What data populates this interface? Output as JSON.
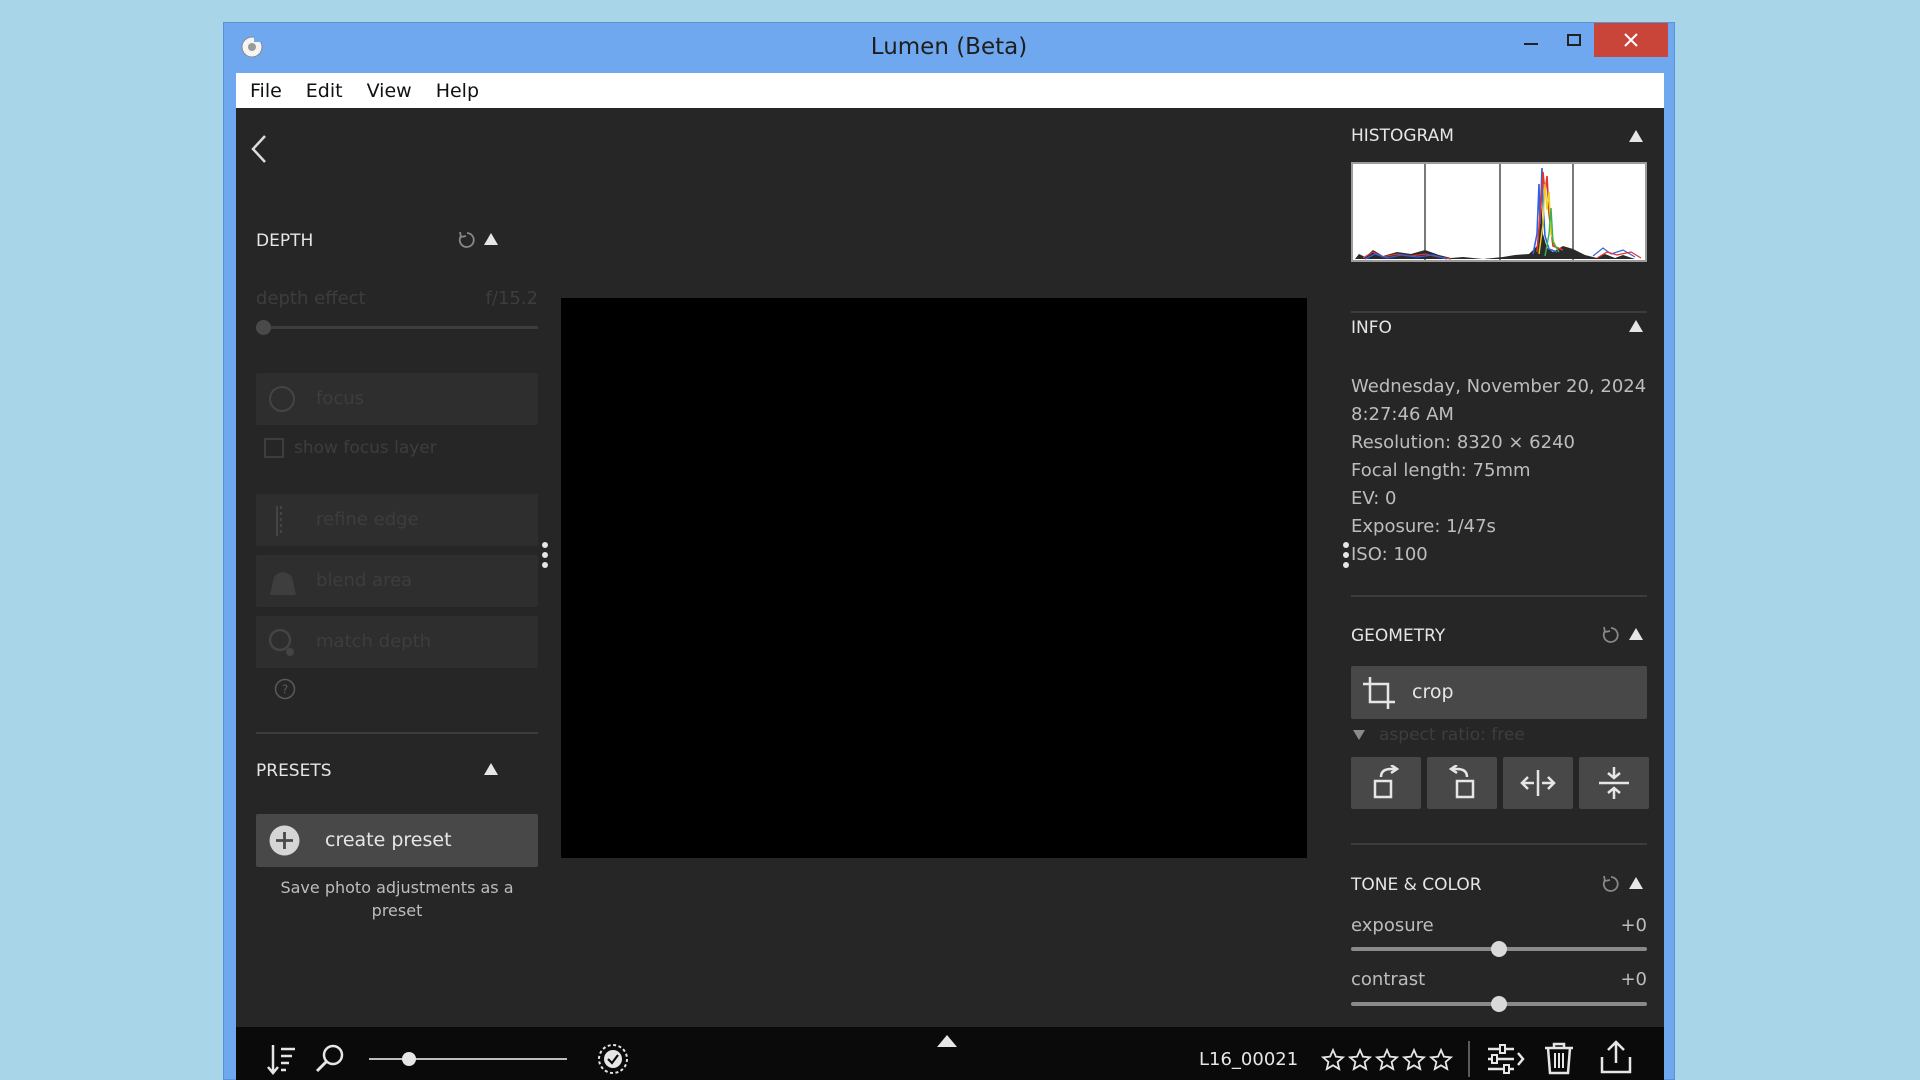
{
  "window": {
    "title": "Lumen (Beta)"
  },
  "menu": [
    "File",
    "Edit",
    "View",
    "Help"
  ],
  "left_panel": {
    "depth": {
      "title": "DEPTH",
      "effect_label": "depth effect",
      "effect_value": "f/15.2",
      "focus_label": "focus",
      "show_focus_label": "show focus layer",
      "refine_edge_label": "refine edge",
      "blend_area_label": "blend area",
      "match_depth_label": "match depth"
    },
    "presets": {
      "title": "PRESETS",
      "create_label": "create preset",
      "hint": "Save photo adjustments as a preset"
    }
  },
  "right_panel": {
    "histogram": {
      "title": "HISTOGRAM"
    },
    "info": {
      "title": "INFO",
      "date": "Wednesday, November 20, 2024",
      "time": "8:27:46 AM",
      "resolution": "Resolution: 8320 × 6240",
      "focal_length": "Focal length: 75mm",
      "ev": "EV: 0",
      "exposure": "Exposure: 1/47s",
      "iso": "ISO: 100"
    },
    "geometry": {
      "title": "GEOMETRY",
      "crop_label": "crop",
      "aspect_label": "aspect ratio: free"
    },
    "tone_color": {
      "title": "TONE & COLOR",
      "sliders": [
        {
          "label": "exposure",
          "value": "+0",
          "level": 0.5
        },
        {
          "label": "contrast",
          "value": "+0",
          "level": 0.5
        }
      ]
    }
  },
  "bottom_bar": {
    "filename": "L16_00021",
    "rating": 0,
    "rating_max": 5,
    "zoom_level": 0.2
  },
  "colors": {
    "desktop": "#a9d5e9",
    "titlebar": "#6fa8ef",
    "close": "#c9453a",
    "panel": "#262626"
  }
}
